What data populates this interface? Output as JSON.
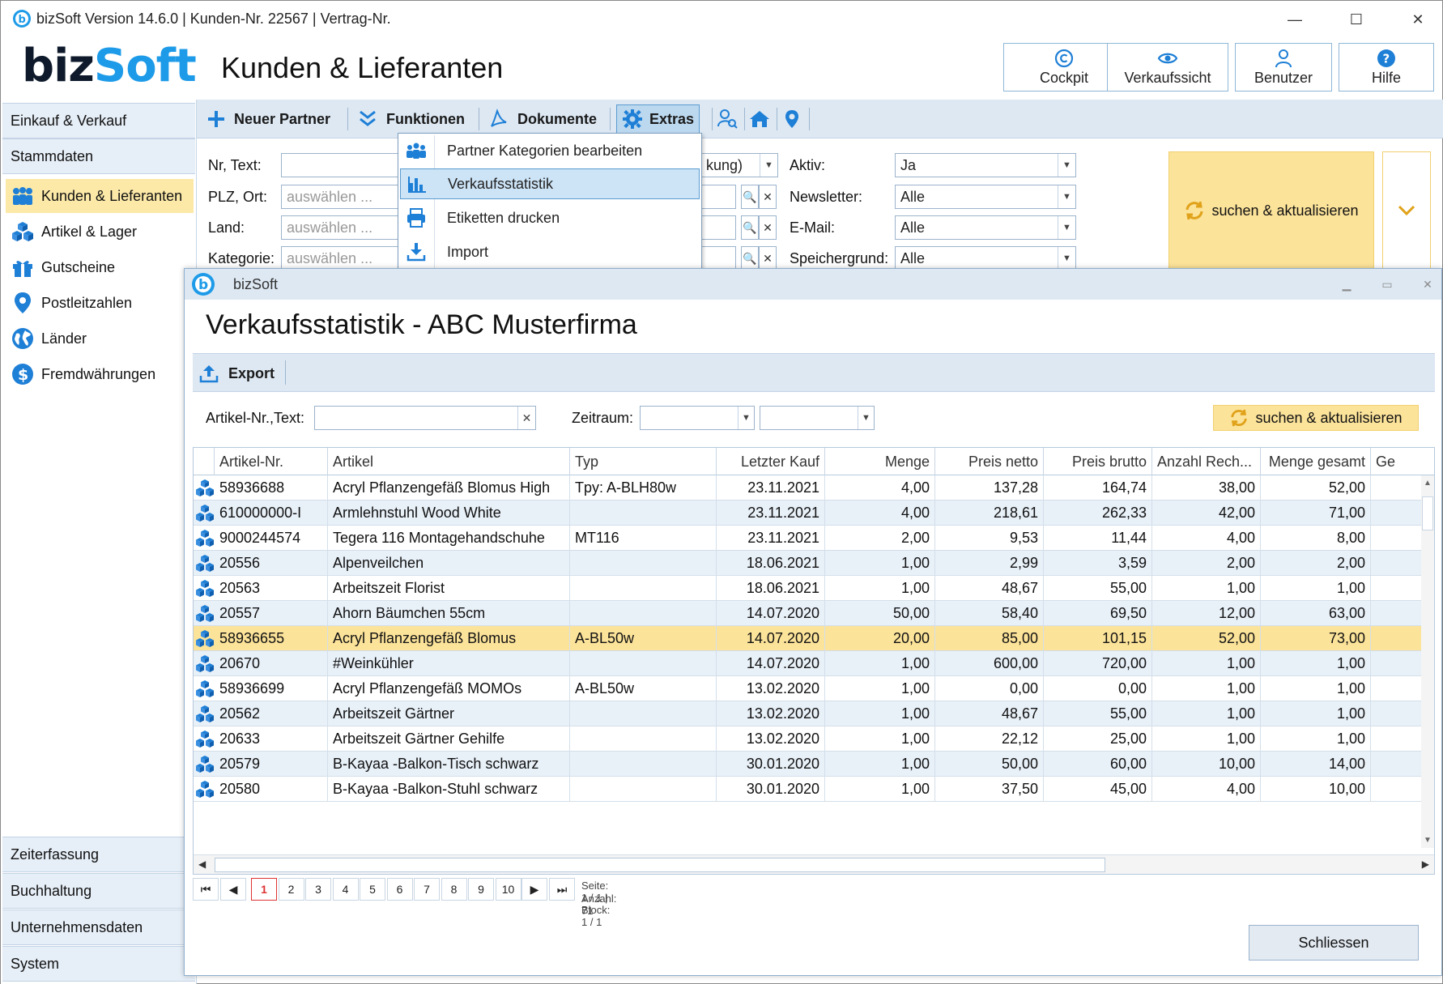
{
  "window": {
    "title": "bizSoft Version 14.6.0 | Kunden-Nr. 22567 | Vertrag-Nr.",
    "minimize": "—",
    "maximize": "☐",
    "close": "✕"
  },
  "brand": {
    "logo_biz": "biz",
    "logo_soft": "Soft",
    "heading": "Kunden & Lieferanten"
  },
  "top_buttons": [
    {
      "label": "Cockpit",
      "icon": "copyright-icon"
    },
    {
      "label": "Verkaufssicht",
      "icon": "eye-icon"
    },
    {
      "label": "Benutzer",
      "icon": "user-icon"
    },
    {
      "label": "Hilfe",
      "icon": "help-icon"
    }
  ],
  "sidebar": {
    "sections_top": [
      "Einkauf & Verkauf",
      "Stammdaten"
    ],
    "items": [
      {
        "label": "Kunden & Lieferanten",
        "active": true
      },
      {
        "label": "Artikel & Lager"
      },
      {
        "label": "Gutscheine"
      },
      {
        "label": "Postleitzahlen"
      },
      {
        "label": "Länder"
      },
      {
        "label": "Fremdwährungen"
      }
    ],
    "sections_bottom": [
      "Zeiterfassung",
      "Buchhaltung",
      "Unternehmensdaten",
      "System"
    ]
  },
  "toolbar": {
    "new_partner": "Neuer Partner",
    "functions": "Funktionen",
    "documents": "Dokumente",
    "extras": "Extras"
  },
  "filter": {
    "nr_text_label": "Nr, Text:",
    "plz_ort_label": "PLZ, Ort:",
    "land_label": "Land:",
    "kategorie_label": "Kategorie:",
    "placeholder": "auswählen ...",
    "partial_value": "kung)",
    "aktiv_label": "Aktiv:",
    "aktiv_value": "Ja",
    "newsletter_label": "Newsletter:",
    "newsletter_value": "Alle",
    "email_label": "E-Mail:",
    "email_value": "Alle",
    "speichergrund_label": "Speichergrund:",
    "speichergrund_value": "Alle",
    "search_button": "suchen & aktualisieren"
  },
  "extras_menu": [
    {
      "label": "Partner Kategorien bearbeiten",
      "icon": "categories-icon"
    },
    {
      "label": "Verkaufsstatistik",
      "icon": "bar-chart-icon",
      "hover": true
    },
    {
      "label": "Etiketten drucken",
      "icon": "printer-icon"
    },
    {
      "label": "Import",
      "icon": "import-icon"
    }
  ],
  "dialog": {
    "title": "bizSoft",
    "heading": "Verkaufsstatistik - ABC Musterfirma",
    "export": "Export",
    "article_label": "Artikel-Nr.,Text:",
    "period_label": "Zeitraum:",
    "search_button": "suchen & aktualisieren",
    "close_button": "Schliessen",
    "columns": [
      "Artikel-Nr.",
      "Artikel",
      "Typ",
      "Letzter Kauf",
      "Menge",
      "Preis netto",
      "Preis brutto",
      "Anzahl Rech...",
      "Menge gesamt",
      "Ge"
    ],
    "rows": [
      {
        "nr": "58936688",
        "artikel": "Acryl Pflanzengefäß Blomus High",
        "typ": "Tpy: A-BLH80w",
        "kauf": "23.11.2021",
        "menge": "4,00",
        "netto": "137,28",
        "brutto": "164,74",
        "anzahl": "38,00",
        "gesamt": "52,00"
      },
      {
        "nr": "610000000-I",
        "artikel": "Armlehnstuhl Wood White",
        "typ": "",
        "kauf": "23.11.2021",
        "menge": "4,00",
        "netto": "218,61",
        "brutto": "262,33",
        "anzahl": "42,00",
        "gesamt": "71,00"
      },
      {
        "nr": "9000244574",
        "artikel": "Tegera 116 Montagehandschuhe",
        "typ": "MT116",
        "kauf": "23.11.2021",
        "menge": "2,00",
        "netto": "9,53",
        "brutto": "11,44",
        "anzahl": "4,00",
        "gesamt": "8,00"
      },
      {
        "nr": "20556",
        "artikel": "Alpenveilchen",
        "typ": "",
        "kauf": "18.06.2021",
        "menge": "1,00",
        "netto": "2,99",
        "brutto": "3,59",
        "anzahl": "2,00",
        "gesamt": "2,00"
      },
      {
        "nr": "20563",
        "artikel": "Arbeitszeit Florist",
        "typ": "",
        "kauf": "18.06.2021",
        "menge": "1,00",
        "netto": "48,67",
        "brutto": "55,00",
        "anzahl": "1,00",
        "gesamt": "1,00"
      },
      {
        "nr": "20557",
        "artikel": "Ahorn Bäumchen 55cm",
        "typ": "",
        "kauf": "14.07.2020",
        "menge": "50,00",
        "netto": "58,40",
        "brutto": "69,50",
        "anzahl": "12,00",
        "gesamt": "63,00"
      },
      {
        "nr": "58936655",
        "artikel": "Acryl Pflanzengefäß Blomus",
        "typ": "A-BL50w",
        "kauf": "14.07.2020",
        "menge": "20,00",
        "netto": "85,00",
        "brutto": "101,15",
        "anzahl": "52,00",
        "gesamt": "73,00",
        "selected": true
      },
      {
        "nr": "20670",
        "artikel": "#Weinkühler",
        "typ": "",
        "kauf": "14.07.2020",
        "menge": "1,00",
        "netto": "600,00",
        "brutto": "720,00",
        "anzahl": "1,00",
        "gesamt": "1,00"
      },
      {
        "nr": "58936699",
        "artikel": "Acryl Pflanzengefäß MOMOs",
        "typ": "A-BL50w",
        "kauf": "13.02.2020",
        "menge": "1,00",
        "netto": "0,00",
        "brutto": "0,00",
        "anzahl": "1,00",
        "gesamt": "1,00"
      },
      {
        "nr": "20562",
        "artikel": "Arbeitszeit Gärtner",
        "typ": "",
        "kauf": "13.02.2020",
        "menge": "1,00",
        "netto": "48,67",
        "brutto": "55,00",
        "anzahl": "1,00",
        "gesamt": "1,00"
      },
      {
        "nr": "20633",
        "artikel": "Arbeitszeit Gärtner Gehilfe",
        "typ": "",
        "kauf": "13.02.2020",
        "menge": "1,00",
        "netto": "22,12",
        "brutto": "25,00",
        "anzahl": "1,00",
        "gesamt": "1,00"
      },
      {
        "nr": "20579",
        "artikel": "B-Kayaa -Balkon-Tisch schwarz",
        "typ": "",
        "kauf": "30.01.2020",
        "menge": "1,00",
        "netto": "50,00",
        "brutto": "60,00",
        "anzahl": "10,00",
        "gesamt": "14,00"
      },
      {
        "nr": "20580",
        "artikel": "B-Kayaa -Balkon-Stuhl schwarz",
        "typ": "",
        "kauf": "30.01.2020",
        "menge": "1,00",
        "netto": "37,50",
        "brutto": "45,00",
        "anzahl": "4,00",
        "gesamt": "10,00"
      }
    ],
    "pager": {
      "first": "⏮",
      "prev": "◀",
      "pages": [
        "1",
        "2",
        "3",
        "4",
        "5",
        "6",
        "7",
        "8",
        "9",
        "10"
      ],
      "current": "1",
      "next": "▶",
      "last": "⏭",
      "info_line1": "Seite: 1 / 1 | Block: 1 / 1",
      "info_line2": "Anzahl: 71"
    }
  },
  "colors": {
    "accent_blue": "#1e9be8",
    "highlight_yellow": "#fce39a",
    "toolbar_blue": "#dde8f3"
  }
}
